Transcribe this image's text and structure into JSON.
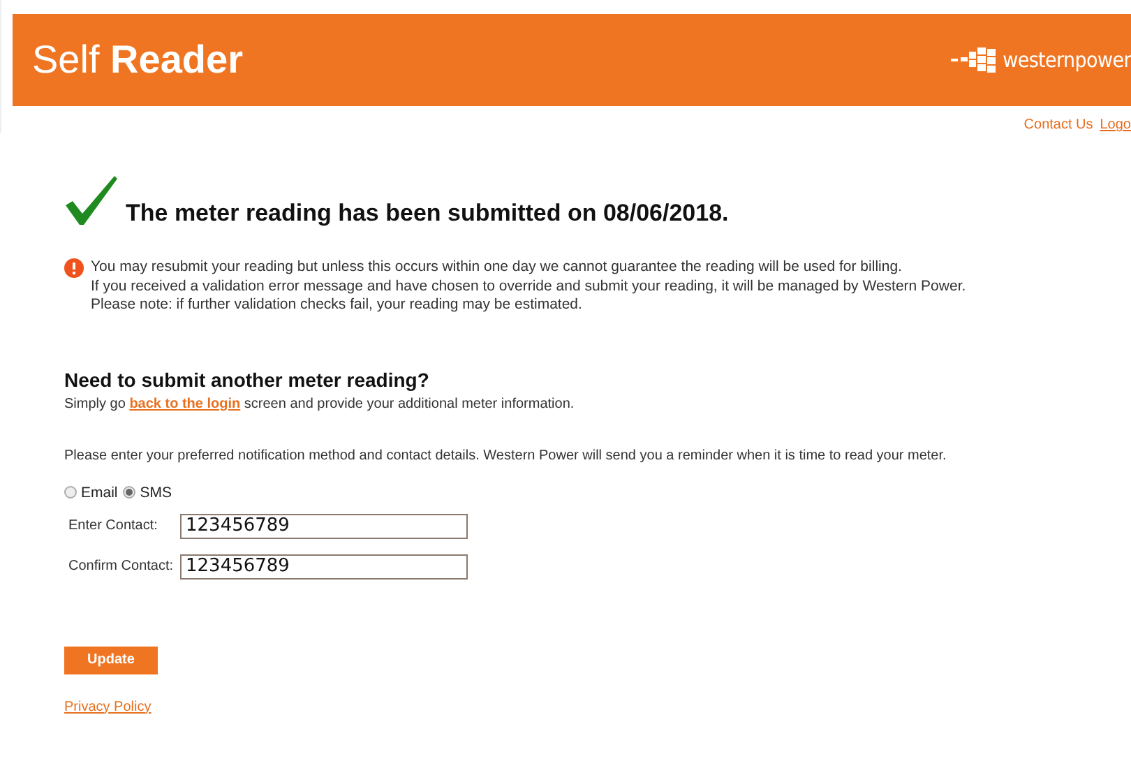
{
  "header": {
    "title": "Self **Reader**",
    "logo_text": "westernpower"
  },
  "top_links": [
    "Contact Us",
    "Logo"
  ],
  "confirmation": {
    "heading": "The meter reading has been submitted on 08/06/2018."
  },
  "notice": {
    "lines": [
      "You may resubmit your reading but unless this occurs within one day we cannot guarantee the reading will be used for billing.",
      "If you received a validation error message and have chosen to override and submit your reading, it will be managed by Western Power.",
      "Please note: if further validation checks fail, your reading may be estimated."
    ]
  },
  "another": {
    "heading": "Need to submit another meter reading?",
    "before": "Simply go ",
    "link": "back to the login",
    "after": " screen and provide your additional meter information."
  },
  "instructions": "Please enter your preferred notification method and contact details. Western Power will send you a reminder when it is time to read your meter.",
  "methods": [
    {
      "label": "Email",
      "selected": false
    },
    {
      "label": "SMS",
      "selected": true
    }
  ],
  "fields": [
    {
      "label": "Enter Contact:",
      "value": "123456789"
    },
    {
      "label": "Confirm Contact:",
      "value": "123456789"
    }
  ],
  "update_button": "Update",
  "privacy_link": "Privacy Policy"
}
